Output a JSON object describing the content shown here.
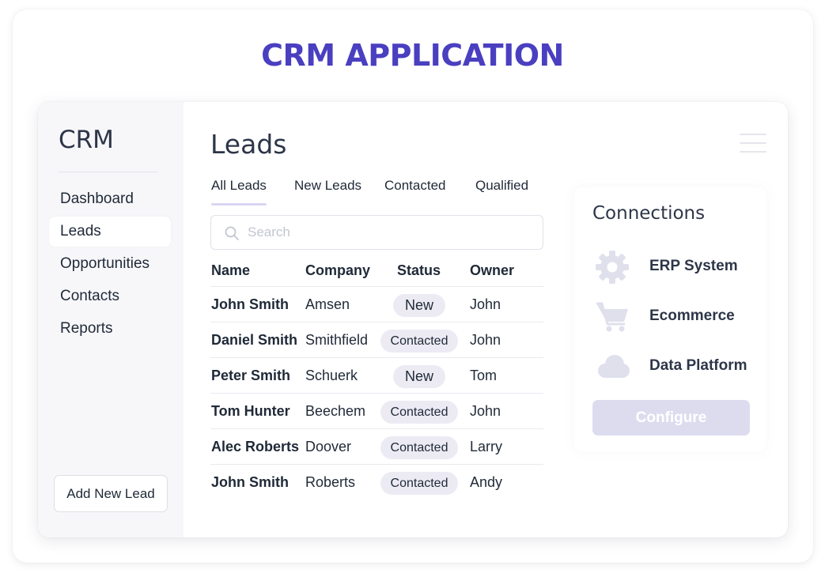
{
  "hero_title": "CRM APPLICATION",
  "sidebar": {
    "brand": "CRM",
    "items": [
      {
        "label": "Dashboard",
        "active": false
      },
      {
        "label": "Leads",
        "active": true
      },
      {
        "label": "Opportunities",
        "active": false
      },
      {
        "label": "Contacts",
        "active": false
      },
      {
        "label": "Reports",
        "active": false
      }
    ],
    "add_button": "Add New Lead"
  },
  "main": {
    "title": "Leads",
    "menu_icon": "hamburger-menu-icon",
    "tabs": [
      {
        "label": "All Leads",
        "active": true
      },
      {
        "label": "New Leads",
        "active": false
      },
      {
        "label": "Contacted",
        "active": false
      },
      {
        "label": "Qualified",
        "active": false
      }
    ],
    "search": {
      "placeholder": "Search",
      "value": "",
      "icon": "search-icon"
    },
    "table": {
      "columns": [
        "Name",
        "Company",
        "Status",
        "Owner"
      ],
      "rows": [
        {
          "name": "John Smith",
          "company": "Amsen",
          "status": "New",
          "owner": "John"
        },
        {
          "name": "Daniel Smith",
          "company": "Smithfield",
          "status": "Contacted",
          "owner": "John"
        },
        {
          "name": "Peter Smith",
          "company": "Schuerk",
          "status": "New",
          "owner": "Tom"
        },
        {
          "name": "Tom Hunter",
          "company": "Beechem",
          "status": "Contacted",
          "owner": "John"
        },
        {
          "name": "Alec Roberts",
          "company": "Doover",
          "status": "Contacted",
          "owner": "Larry"
        },
        {
          "name": "John Smith",
          "company": "Roberts",
          "status": "Contacted",
          "owner": "Andy"
        }
      ]
    }
  },
  "connections": {
    "title": "Connections",
    "items": [
      {
        "label": "ERP System",
        "icon": "gear-icon"
      },
      {
        "label": "Ecommerce",
        "icon": "shopping-cart-icon"
      },
      {
        "label": "Data Platform",
        "icon": "cloud-icon"
      }
    ],
    "configure_button": "Configure"
  },
  "colors": {
    "accent": "#4a3fc0",
    "pill_bg": "#ecebf4",
    "configure_bg": "#dddcef",
    "icon_tint": "#dfe0ec"
  }
}
